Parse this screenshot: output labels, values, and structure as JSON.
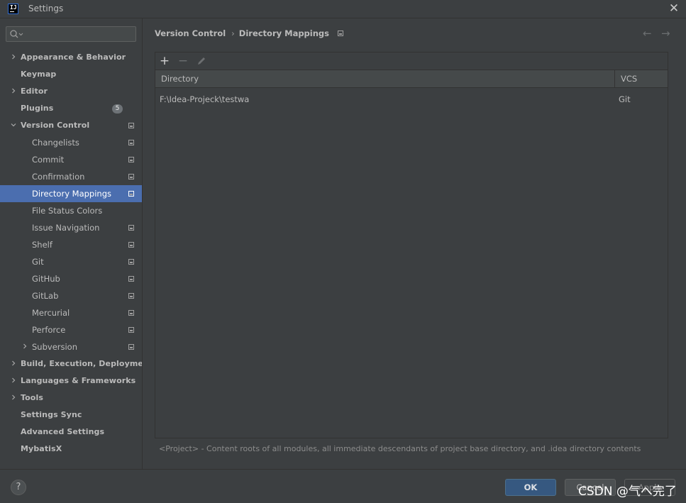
{
  "window": {
    "title": "Settings",
    "app_icon_text": "IJ"
  },
  "search": {
    "placeholder": ""
  },
  "sidebar": {
    "items": [
      {
        "label": "Appearance & Behavior",
        "level": 0,
        "expandable": true,
        "expanded": false
      },
      {
        "label": "Keymap",
        "level": 0
      },
      {
        "label": "Editor",
        "level": 0,
        "expandable": true,
        "expanded": false
      },
      {
        "label": "Plugins",
        "level": 0,
        "badge": "5"
      },
      {
        "label": "Version Control",
        "level": 0,
        "expandable": true,
        "expanded": true,
        "project_icon": true
      },
      {
        "label": "Changelists",
        "level": 1,
        "project_icon": true
      },
      {
        "label": "Commit",
        "level": 1,
        "project_icon": true
      },
      {
        "label": "Confirmation",
        "level": 1,
        "project_icon": true
      },
      {
        "label": "Directory Mappings",
        "level": 1,
        "project_icon": true,
        "selected": true
      },
      {
        "label": "File Status Colors",
        "level": 1
      },
      {
        "label": "Issue Navigation",
        "level": 1,
        "project_icon": true
      },
      {
        "label": "Shelf",
        "level": 1,
        "project_icon": true
      },
      {
        "label": "Git",
        "level": 1,
        "project_icon": true
      },
      {
        "label": "GitHub",
        "level": 1,
        "project_icon": true
      },
      {
        "label": "GitLab",
        "level": 1,
        "project_icon": true
      },
      {
        "label": "Mercurial",
        "level": 1,
        "project_icon": true
      },
      {
        "label": "Perforce",
        "level": 1,
        "project_icon": true
      },
      {
        "label": "Subversion",
        "level": 1,
        "expandable": true,
        "expanded": false,
        "project_icon": true
      },
      {
        "label": "Build, Execution, Deployment",
        "level": 0,
        "expandable": true,
        "expanded": false
      },
      {
        "label": "Languages & Frameworks",
        "level": 0,
        "expandable": true,
        "expanded": false
      },
      {
        "label": "Tools",
        "level": 0,
        "expandable": true,
        "expanded": false
      },
      {
        "label": "Settings Sync",
        "level": 0
      },
      {
        "label": "Advanced Settings",
        "level": 0
      },
      {
        "label": "MybatisX",
        "level": 0
      }
    ]
  },
  "breadcrumb": {
    "parent": "Version Control",
    "current": "Directory Mappings"
  },
  "toolbar": {
    "add": "+",
    "remove": "−",
    "edit": "edit-icon"
  },
  "table": {
    "columns": [
      "Directory",
      "VCS"
    ],
    "rows": [
      {
        "directory": "F:\\Idea-Projeck\\testwa",
        "vcs": "Git"
      }
    ]
  },
  "hint": "<Project> - Content roots of all modules, all immediate descendants of project base directory, and .idea directory contents",
  "footer": {
    "help": "?",
    "ok": "OK",
    "cancel": "Cancel",
    "apply": "Apply"
  },
  "watermark": "CSDN @气へ完了",
  "colors": {
    "selection": "#4b6eaf",
    "ok_button": "#365880",
    "background": "#3c3f41"
  }
}
